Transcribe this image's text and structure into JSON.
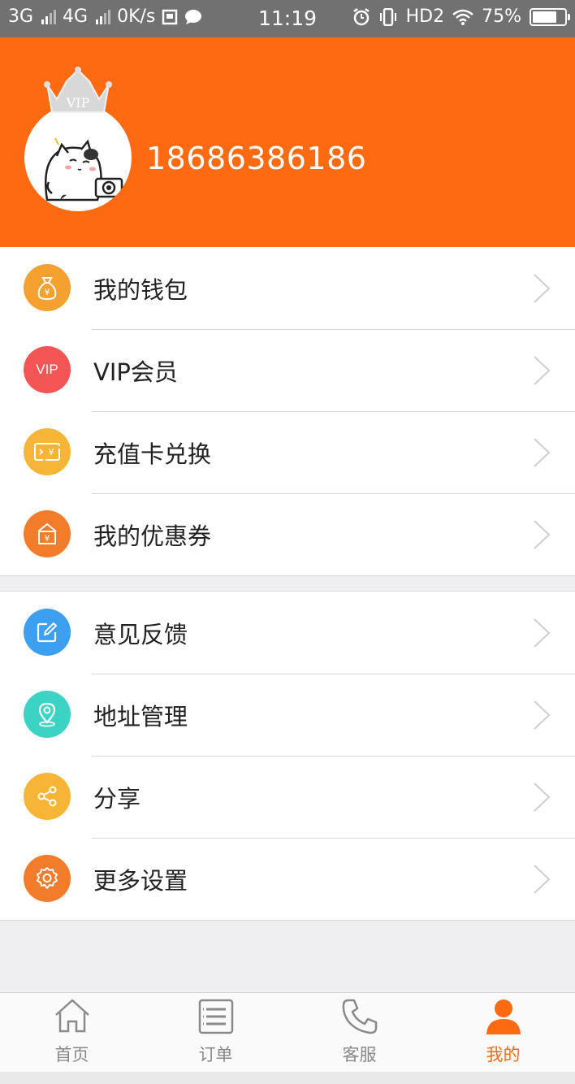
{
  "status_bar": {
    "net1": "3G",
    "net2": "4G",
    "speed": "0K/s",
    "time": "11:19",
    "hd": "HD2",
    "battery": "75%",
    "battery_level": 0.75
  },
  "profile": {
    "vip_badge": "VIP",
    "phone": "18686386186"
  },
  "menu_group_1": [
    {
      "label": "我的钱包",
      "icon": "wallet-icon",
      "color": "#f5a131"
    },
    {
      "label": "VIP会员",
      "icon": "vip-icon",
      "icon_text": "VIP",
      "color": "#f35555"
    },
    {
      "label": "充值卡兑换",
      "icon": "card-exchange-icon",
      "color": "#f6b536"
    },
    {
      "label": "我的优惠券",
      "icon": "coupon-icon",
      "color": "#f37c2b"
    }
  ],
  "menu_group_2": [
    {
      "label": "意见反馈",
      "icon": "feedback-icon",
      "color": "#3d9ff0"
    },
    {
      "label": "地址管理",
      "icon": "location-icon",
      "color": "#3dd3c4"
    },
    {
      "label": "分享",
      "icon": "share-icon",
      "color": "#f6b536"
    },
    {
      "label": "更多设置",
      "icon": "settings-icon",
      "color": "#f37c2b"
    }
  ],
  "tab_bar": [
    {
      "label": "首页",
      "icon": "home-icon",
      "active": false
    },
    {
      "label": "订单",
      "icon": "order-list-icon",
      "active": false
    },
    {
      "label": "客服",
      "icon": "phone-icon",
      "active": false
    },
    {
      "label": "我的",
      "icon": "user-icon",
      "active": true
    }
  ],
  "colors": {
    "brand": "#fd6a11",
    "background": "#efeff1"
  }
}
